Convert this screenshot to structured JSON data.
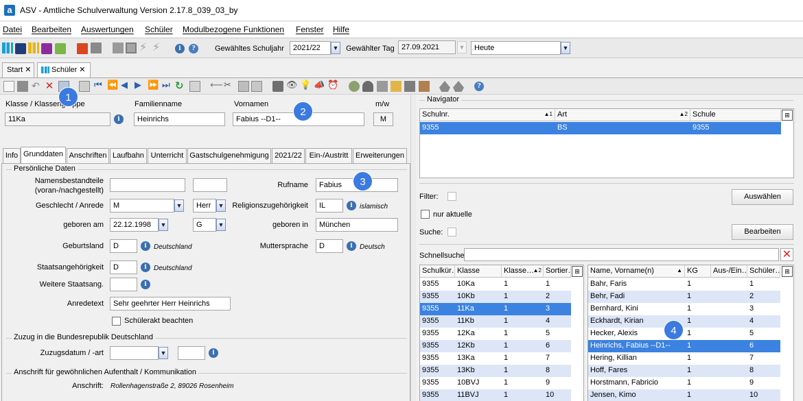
{
  "app": {
    "logo": "a",
    "title": "ASV - Amtliche Schulverwaltung Version 2.17.8_039_03_by"
  },
  "menu": [
    "Datei",
    "Bearbeiten",
    "Auswertungen",
    "Schüler",
    "Modulbezogene Funktionen",
    "Fenster",
    "Hilfe"
  ],
  "toolbar": {
    "schuljahr_label": "Gewähltes Schuljahr",
    "schuljahr": "2021/22",
    "tag_label": "Gewählter Tag",
    "tag": "27.09.2021",
    "heute": "Heute"
  },
  "doctabs": [
    {
      "label": "Start"
    },
    {
      "label": "Schüler"
    }
  ],
  "header": {
    "klasse_label": "Klasse / Klassengruppe",
    "klasse": "11Ka",
    "familienname_label": "Familienname",
    "familienname": "Heinrichs",
    "vornamen_label": "Vornamen",
    "vornamen": "Fabius --D1--",
    "mw_label": "m/w",
    "mw": "M"
  },
  "tabs": [
    "Info",
    "Grunddaten",
    "Anschriften",
    "Laufbahn",
    "Unterricht",
    "Gastschulgenehmigung",
    "2021/22",
    "Ein-/Austritt",
    "Erweiterungen"
  ],
  "form": {
    "section_personal": "Persönliche Daten",
    "namensbestandteile_label": "Namensbestandteile (voran-/nachgestellt)",
    "rufname_label": "Rufname",
    "rufname": "Fabius",
    "geschlecht_label": "Geschlecht / Anrede",
    "geschlecht": "M",
    "anrede": "Herr",
    "religion_label": "Religionszugehörigkeit",
    "religion": "IL",
    "religion_text": "islamisch",
    "geboren_am_label": "geboren am",
    "geboren_am": "22.12.1998",
    "g_value": "G",
    "geboren_in_label": "geboren in",
    "geboren_in": "München",
    "geburtsland_label": "Geburtsland",
    "geburtsland": "D",
    "geburtsland_text": "Deutschland",
    "muttersprache_label": "Muttersprache",
    "muttersprache": "D",
    "muttersprache_text": "Deutsch",
    "staat_label": "Staatsangehörigkeit",
    "staat": "D",
    "staat_text": "Deutschland",
    "weitere_label": "Weitere Staatsang.",
    "anredetext_label": "Anredetext",
    "anredetext": "Sehr geehrter Herr Heinrichs",
    "schuelerakt_label": "Schülerakt beachten",
    "section_zuzug": "Zuzug in die Bundesrepublik Deutschland",
    "zuzug_label": "Zuzugsdatum / -art",
    "section_anschrift": "Anschrift für gewöhnlichen Aufenthalt / Kommunikation",
    "anschrift_label": "Anschrift:",
    "anschrift": "Rollenhagenstraße 2, 89026 Rosenheim"
  },
  "navigator": {
    "title": "Navigator",
    "columns": [
      "Schulnr.",
      "Art",
      "Schule"
    ],
    "col_sort": [
      "▲1",
      "▲2"
    ],
    "rows": [
      [
        "9355",
        "BS",
        "9355"
      ]
    ],
    "filter_label": "Filter:",
    "nur_aktuelle": "nur aktuelle",
    "suche_label": "Suche:",
    "auswaehlen": "Auswählen",
    "bearbeiten": "Bearbeiten",
    "schnellsuche": "Schnellsuche"
  },
  "classes": {
    "columns": [
      "Schulkür…",
      "Klasse",
      "Klasse…",
      "Sortier…"
    ],
    "sort_mark": "▲2",
    "rows": [
      [
        "9355",
        "10Ka",
        "1",
        "1"
      ],
      [
        "9355",
        "10Kb",
        "1",
        "2"
      ],
      [
        "9355",
        "11Ka",
        "1",
        "3"
      ],
      [
        "9355",
        "11Kb",
        "1",
        "4"
      ],
      [
        "9355",
        "12Ka",
        "1",
        "5"
      ],
      [
        "9355",
        "12Kb",
        "1",
        "6"
      ],
      [
        "9355",
        "13Ka",
        "1",
        "7"
      ],
      [
        "9355",
        "13Kb",
        "1",
        "8"
      ],
      [
        "9355",
        "10BVJ",
        "1",
        "9"
      ],
      [
        "9355",
        "11BVJ",
        "1",
        "10"
      ]
    ],
    "selected": 2
  },
  "students": {
    "columns": [
      "Name, Vorname(n)",
      "KG",
      "Aus-/Ein…",
      "Schüler…"
    ],
    "sort_mark": "▲",
    "rows": [
      [
        "Bahr, Faris",
        "1",
        "",
        "1"
      ],
      [
        "Behr, Fadi",
        "1",
        "",
        "2"
      ],
      [
        "Bernhard, Kini",
        "1",
        "",
        "3"
      ],
      [
        "Eckhardt, Kirian",
        "1",
        "",
        "4"
      ],
      [
        "Hecker, Alexis",
        "1",
        "",
        "5"
      ],
      [
        "Heinrichs, Fabius --D1--",
        "1",
        "",
        "6"
      ],
      [
        "Hering, Killian",
        "1",
        "",
        "7"
      ],
      [
        "Hoff, Fares",
        "1",
        "",
        "8"
      ],
      [
        "Horstmann, Fabricio",
        "1",
        "",
        "9"
      ],
      [
        "Jensen, Kimo",
        "1",
        "",
        "10"
      ]
    ],
    "selected": 5
  },
  "badges": [
    "1",
    "2",
    "3",
    "4"
  ]
}
